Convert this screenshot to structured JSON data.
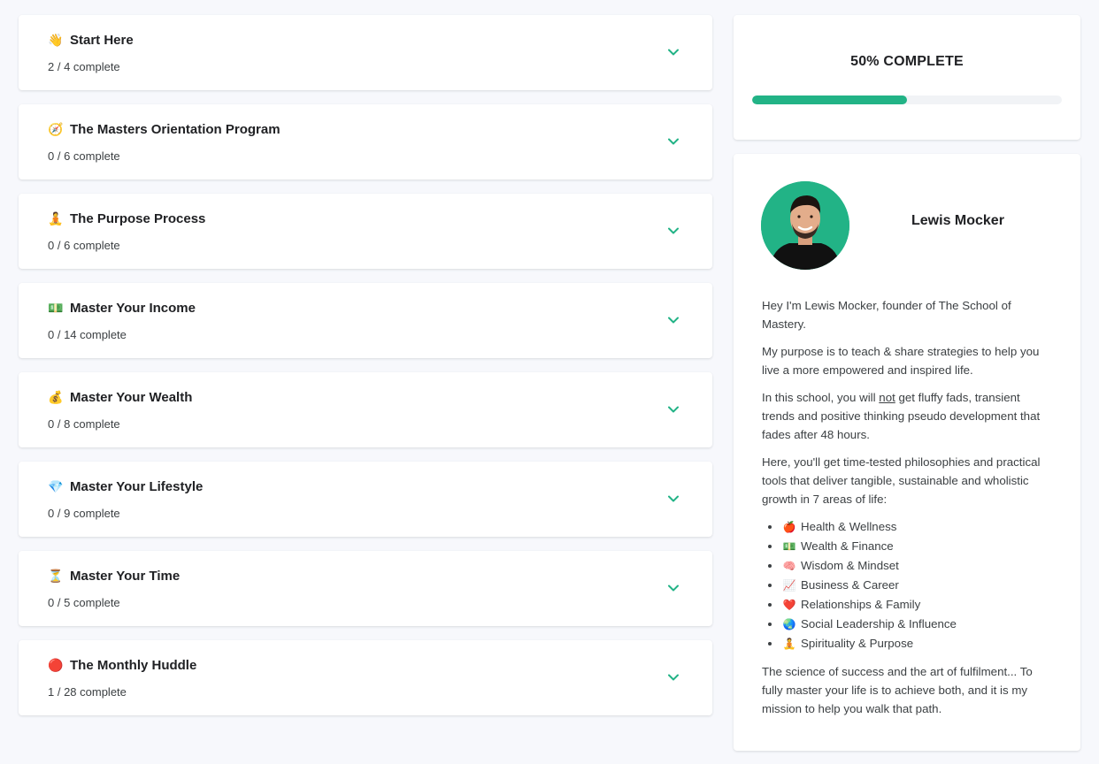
{
  "modules": [
    {
      "title": "Start Here",
      "progress": "2 / 4 complete",
      "emoji": "👋",
      "icon": "waving-hand-icon"
    },
    {
      "title": "The Masters Orientation Program",
      "progress": "0 / 6 complete",
      "emoji": "🧭",
      "icon": "compass-icon"
    },
    {
      "title": "The Purpose Process",
      "progress": "0 / 6 complete",
      "emoji": "🧘",
      "icon": "meditating-person-icon"
    },
    {
      "title": "Master Your Income",
      "progress": "0 / 14 complete",
      "emoji": "💵",
      "icon": "dollar-bill-icon"
    },
    {
      "title": "Master Your Wealth",
      "progress": "0 / 8 complete",
      "emoji": "💰",
      "icon": "money-bag-icon"
    },
    {
      "title": "Master Your Lifestyle",
      "progress": "0 / 9 complete",
      "emoji": "💎",
      "icon": "gem-icon"
    },
    {
      "title": "Master Your Time",
      "progress": "0 / 5 complete",
      "emoji": "⏳",
      "icon": "hourglass-icon"
    },
    {
      "title": "The Monthly Huddle",
      "progress": "1 / 28 complete",
      "emoji": "🔴",
      "icon": "red-circle-icon"
    }
  ],
  "completion": {
    "label": "50% COMPLETE",
    "percent": 50
  },
  "owner": {
    "name": "Lewis Mocker"
  },
  "bio": {
    "p1": "Hey I'm Lewis Mocker, founder of The School of Mastery.",
    "p2": "My purpose is to teach & share strategies to help you live a more empowered and inspired life.",
    "p3_before": "In this school, you will ",
    "p3_underline": "not",
    "p3_after": " get fluffy fads, transient trends and positive thinking pseudo development that fades after 48 hours.",
    "p4": "Here, you'll get time-tested philosophies and practical tools that deliver tangible, sustainable and wholistic growth in 7 areas of life:",
    "areas": [
      {
        "emoji": "🍎",
        "label": "Health & Wellness"
      },
      {
        "emoji": "💵",
        "label": "Wealth & Finance"
      },
      {
        "emoji": "🧠",
        "label": "Wisdom & Mindset"
      },
      {
        "emoji": "📈",
        "label": "Business & Career"
      },
      {
        "emoji": "❤️",
        "label": "Relationships & Family"
      },
      {
        "emoji": "🌏",
        "label": "Social Leadership & Influence"
      },
      {
        "emoji": "🧘",
        "label": "Spirituality & Purpose"
      }
    ],
    "p5": "The science of success and the art of fulfilment... To fully master your life is to achieve both, and it is my mission to help you walk that path."
  },
  "colors": {
    "accent": "#22b386",
    "background": "#f7f8fc"
  }
}
